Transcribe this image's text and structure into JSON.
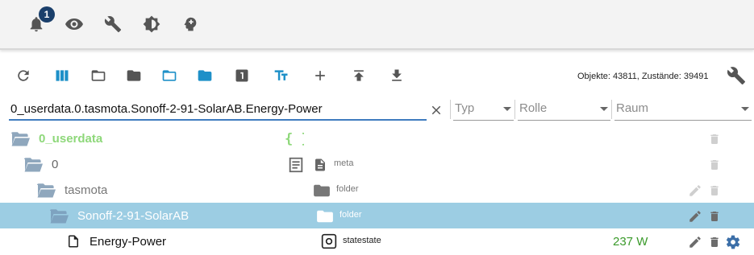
{
  "topbar": {
    "notification_count": "1",
    "icons": [
      "bell-icon",
      "eye-icon",
      "wrench-icon",
      "brightness-icon",
      "expert-head-icon"
    ]
  },
  "toolbar": {
    "icons": [
      "refresh-icon",
      "columns-icon",
      "folder-open-icon",
      "folder-closed-icon",
      "folder-open-blue-icon",
      "folder-blue-icon",
      "one-icon",
      "text-size-icon",
      "plus-icon",
      "upload-icon",
      "download-icon",
      "settings-wrench-icon"
    ],
    "stats": "Objekte: 43811, Zustände: 39491"
  },
  "filter": {
    "path_value": "0_userdata.0.tasmota.Sonoff-2-91-SolarAB.Energy-Power",
    "type_label": "Typ",
    "role_label": "Rolle",
    "room_label": "Raum"
  },
  "rows": [
    {
      "name": "0_userdata",
      "type": "",
      "role": ""
    },
    {
      "name": "0",
      "type": "",
      "role": "meta"
    },
    {
      "name": "tasmota",
      "type": "",
      "role": "folder"
    },
    {
      "name": "Sonoff-2-91-SolarAB",
      "type": "",
      "role": "folder"
    },
    {
      "name": "Energy-Power",
      "type": "",
      "role": "statestate",
      "value": "237 W"
    }
  ],
  "colors": {
    "accent_blue": "#1e90c8",
    "selected_row": "#9ccde3",
    "userdata_green": "#8ed87a",
    "value_green": "#3a9a2a",
    "badge": "#1a3f6b"
  }
}
